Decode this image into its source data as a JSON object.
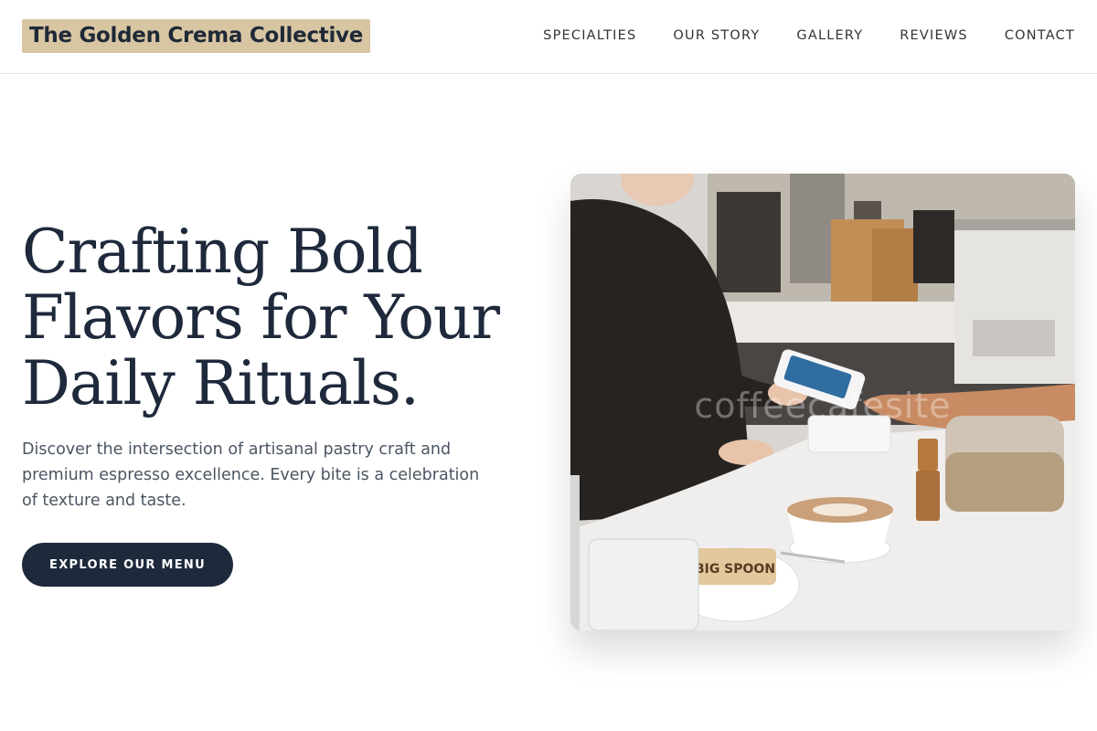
{
  "header": {
    "brand": "The Golden Crema Collective",
    "nav": [
      {
        "label": "SPECIALTIES"
      },
      {
        "label": "OUR STORY"
      },
      {
        "label": "GALLERY"
      },
      {
        "label": "REVIEWS"
      },
      {
        "label": "CONTACT"
      }
    ]
  },
  "hero": {
    "title_lines": [
      "Crafting Bold",
      "Flavors for Your",
      "Daily Rituals."
    ],
    "description": "Discover the intersection of artisanal pastry craft and premium espresso excellence. Every bite is a celebration of texture and taste.",
    "cta_label": "EXPLORE OUR MENU",
    "image": {
      "description": "barista-taking-card-payment-photo",
      "watermark": "coffeecafesite",
      "bag_label": "BIG SPOON"
    }
  },
  "colors": {
    "brand_bg": "#d8c6a3",
    "primary_dark": "#1e293b",
    "text_muted": "#4b5563"
  }
}
